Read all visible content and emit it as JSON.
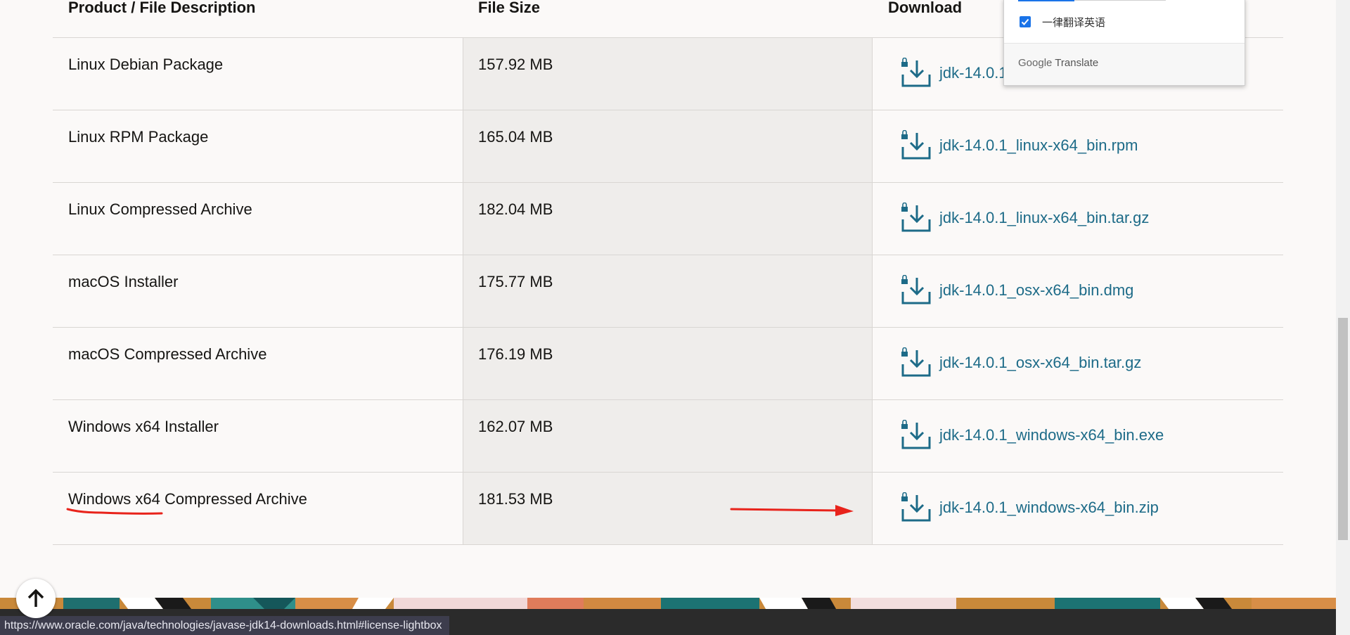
{
  "table": {
    "headers": {
      "description": "Product / File Description",
      "size": "File Size",
      "download": "Download"
    },
    "rows": [
      {
        "description": "Linux Debian Package",
        "size": "157.92 MB",
        "file": "jdk-14.0.1"
      },
      {
        "description": "Linux RPM Package",
        "size": "165.04 MB",
        "file": "jdk-14.0.1_linux-x64_bin.rpm"
      },
      {
        "description": "Linux Compressed Archive",
        "size": "182.04 MB",
        "file": "jdk-14.0.1_linux-x64_bin.tar.gz"
      },
      {
        "description": "macOS Installer",
        "size": "175.77 MB",
        "file": "jdk-14.0.1_osx-x64_bin.dmg"
      },
      {
        "description": "macOS Compressed Archive",
        "size": "176.19 MB",
        "file": "jdk-14.0.1_osx-x64_bin.tar.gz"
      },
      {
        "description": "Windows x64 Installer",
        "size": "162.07 MB",
        "file": "jdk-14.0.1_windows-x64_bin.exe"
      },
      {
        "description": "Windows x64 Compressed Archive",
        "size": "181.53 MB",
        "file": "jdk-14.0.1_windows-x64_bin.zip"
      }
    ]
  },
  "translate_popup": {
    "checkbox_label": "一律翻译英语",
    "brand_google": "Google",
    "brand_translate": "Translate"
  },
  "status_bar": {
    "url": "https://www.oracle.com/java/technologies/javase-jdk14-downloads.html#license-lightbox"
  },
  "icons": {
    "download": "download-lock-icon",
    "to_top": "arrow-up-icon"
  },
  "colors": {
    "link": "#1d6b88",
    "annotation": "#e8231b"
  }
}
